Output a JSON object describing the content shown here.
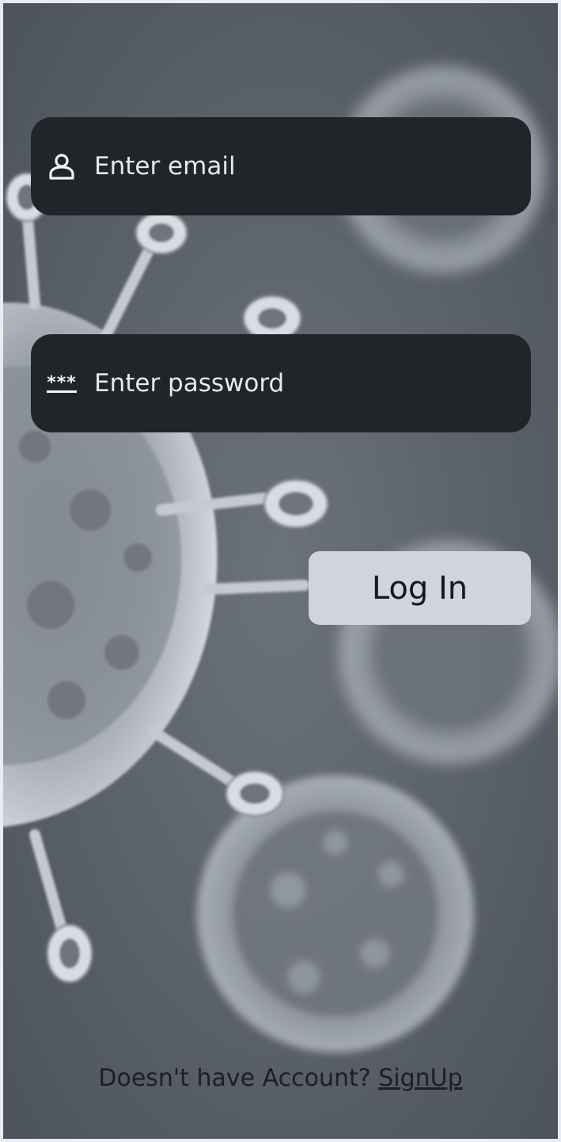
{
  "login_form": {
    "email_placeholder": "Enter email",
    "email_value": "",
    "email_icon": "user-icon",
    "password_placeholder": "Enter password",
    "password_value": "",
    "password_icon": "password-icon",
    "password_icon_glyph": "***",
    "login_label": "Log In"
  },
  "footer": {
    "prompt_text": "Doesn't have Account?",
    "signup_label": "SignUp"
  },
  "colors": {
    "field_background": "#212429",
    "button_background": "#d0d4dc",
    "page_background": "#5f656d",
    "text_light": "#f2f3f5",
    "text_dark": "#1c1f24"
  },
  "background": {
    "image": "virus-particles-image"
  }
}
